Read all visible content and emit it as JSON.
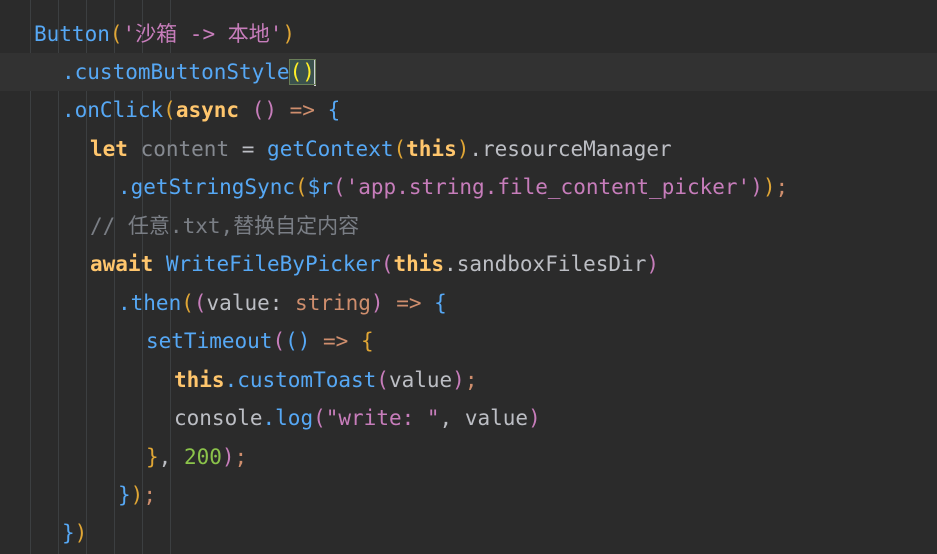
{
  "editor": {
    "lines": [
      {
        "tokens": [
          {
            "t": "Button",
            "c": "tok-method"
          },
          {
            "t": "(",
            "c": "p1"
          },
          {
            "t": "'沙箱 -> 本地'",
            "c": "tok-str"
          },
          {
            "t": ")",
            "c": "p1"
          }
        ]
      },
      {
        "tokens": [
          {
            "t": ".customButtonStyle",
            "c": "tok-method"
          },
          {
            "t": "()",
            "c": "match"
          }
        ],
        "caret": true,
        "current": true
      },
      {
        "tokens": [
          {
            "t": ".onClick",
            "c": "tok-method"
          },
          {
            "t": "(",
            "c": "p1"
          },
          {
            "t": "async",
            "c": "tok-ts-kw"
          },
          {
            "t": " ",
            "c": "tok-plain"
          },
          {
            "t": "()",
            "c": "p2"
          },
          {
            "t": " => ",
            "c": "tok-keyword"
          },
          {
            "t": "{",
            "c": "p3"
          }
        ]
      },
      {
        "tokens": [
          {
            "t": "let",
            "c": "tok-ts-kw"
          },
          {
            "t": " ",
            "c": "tok-plain"
          },
          {
            "t": "content",
            "c": "tok-grey"
          },
          {
            "t": " = ",
            "c": "tok-plain"
          },
          {
            "t": "getContext",
            "c": "tok-fn"
          },
          {
            "t": "(",
            "c": "p1"
          },
          {
            "t": "this",
            "c": "tok-ts-kw"
          },
          {
            "t": ")",
            "c": "p1"
          },
          {
            "t": ".resourceManager",
            "c": "tok-plain"
          }
        ]
      },
      {
        "tokens": [
          {
            "t": ".getStringSync",
            "c": "tok-method"
          },
          {
            "t": "(",
            "c": "p1"
          },
          {
            "t": "$r",
            "c": "tok-dollar"
          },
          {
            "t": "(",
            "c": "p2"
          },
          {
            "t": "'app.string.file_content_picker'",
            "c": "tok-str"
          },
          {
            "t": ")",
            "c": "p2"
          },
          {
            "t": ")",
            "c": "p1"
          },
          {
            "t": ";",
            "c": "tok-keyword"
          }
        ]
      },
      {
        "tokens": [
          {
            "t": "// 任意.txt,替换自定内容",
            "c": "tok-comment"
          }
        ]
      },
      {
        "tokens": [
          {
            "t": "await",
            "c": "tok-ts-kw"
          },
          {
            "t": " ",
            "c": "tok-plain"
          },
          {
            "t": "WriteFileByPicker",
            "c": "tok-fn"
          },
          {
            "t": "(",
            "c": "p2"
          },
          {
            "t": "this",
            "c": "tok-ts-kw"
          },
          {
            "t": ".sandboxFilesDir",
            "c": "tok-plain"
          },
          {
            "t": ")",
            "c": "p2"
          }
        ]
      },
      {
        "tokens": [
          {
            "t": ".then",
            "c": "tok-method"
          },
          {
            "t": "(",
            "c": "p1"
          },
          {
            "t": "(",
            "c": "p2"
          },
          {
            "t": "value",
            "c": "tok-plain"
          },
          {
            "t": ": ",
            "c": "tok-plain"
          },
          {
            "t": "string",
            "c": "tok-type"
          },
          {
            "t": ")",
            "c": "p2"
          },
          {
            "t": " => ",
            "c": "tok-keyword"
          },
          {
            "t": "{",
            "c": "p3"
          }
        ]
      },
      {
        "tokens": [
          {
            "t": "setTimeout",
            "c": "tok-fn"
          },
          {
            "t": "(",
            "c": "p2"
          },
          {
            "t": "()",
            "c": "p3"
          },
          {
            "t": " => ",
            "c": "tok-keyword"
          },
          {
            "t": "{",
            "c": "p1"
          }
        ]
      },
      {
        "tokens": [
          {
            "t": "this",
            "c": "tok-ts-kw"
          },
          {
            "t": ".customToast",
            "c": "tok-method"
          },
          {
            "t": "(",
            "c": "p2"
          },
          {
            "t": "value",
            "c": "tok-plain"
          },
          {
            "t": ")",
            "c": "p2"
          },
          {
            "t": ";",
            "c": "tok-keyword"
          }
        ]
      },
      {
        "tokens": [
          {
            "t": "console",
            "c": "tok-plain"
          },
          {
            "t": ".log",
            "c": "tok-method"
          },
          {
            "t": "(",
            "c": "p2"
          },
          {
            "t": "\"write: \"",
            "c": "tok-strg"
          },
          {
            "t": ", ",
            "c": "tok-plain"
          },
          {
            "t": "value",
            "c": "tok-plain"
          },
          {
            "t": ")",
            "c": "p2"
          }
        ]
      },
      {
        "tokens": [
          {
            "t": "}",
            "c": "p1"
          },
          {
            "t": ", ",
            "c": "tok-plain"
          },
          {
            "t": "200",
            "c": "tok-num"
          },
          {
            "t": ")",
            "c": "p2"
          },
          {
            "t": ";",
            "c": "tok-keyword"
          }
        ]
      },
      {
        "tokens": [
          {
            "t": "}",
            "c": "p3"
          },
          {
            "t": ")",
            "c": "p1"
          },
          {
            "t": ";",
            "c": "tok-keyword"
          }
        ]
      },
      {
        "tokens": [
          {
            "t": "}",
            "c": "p3"
          },
          {
            "t": ")",
            "c": "p1"
          }
        ]
      }
    ]
  }
}
